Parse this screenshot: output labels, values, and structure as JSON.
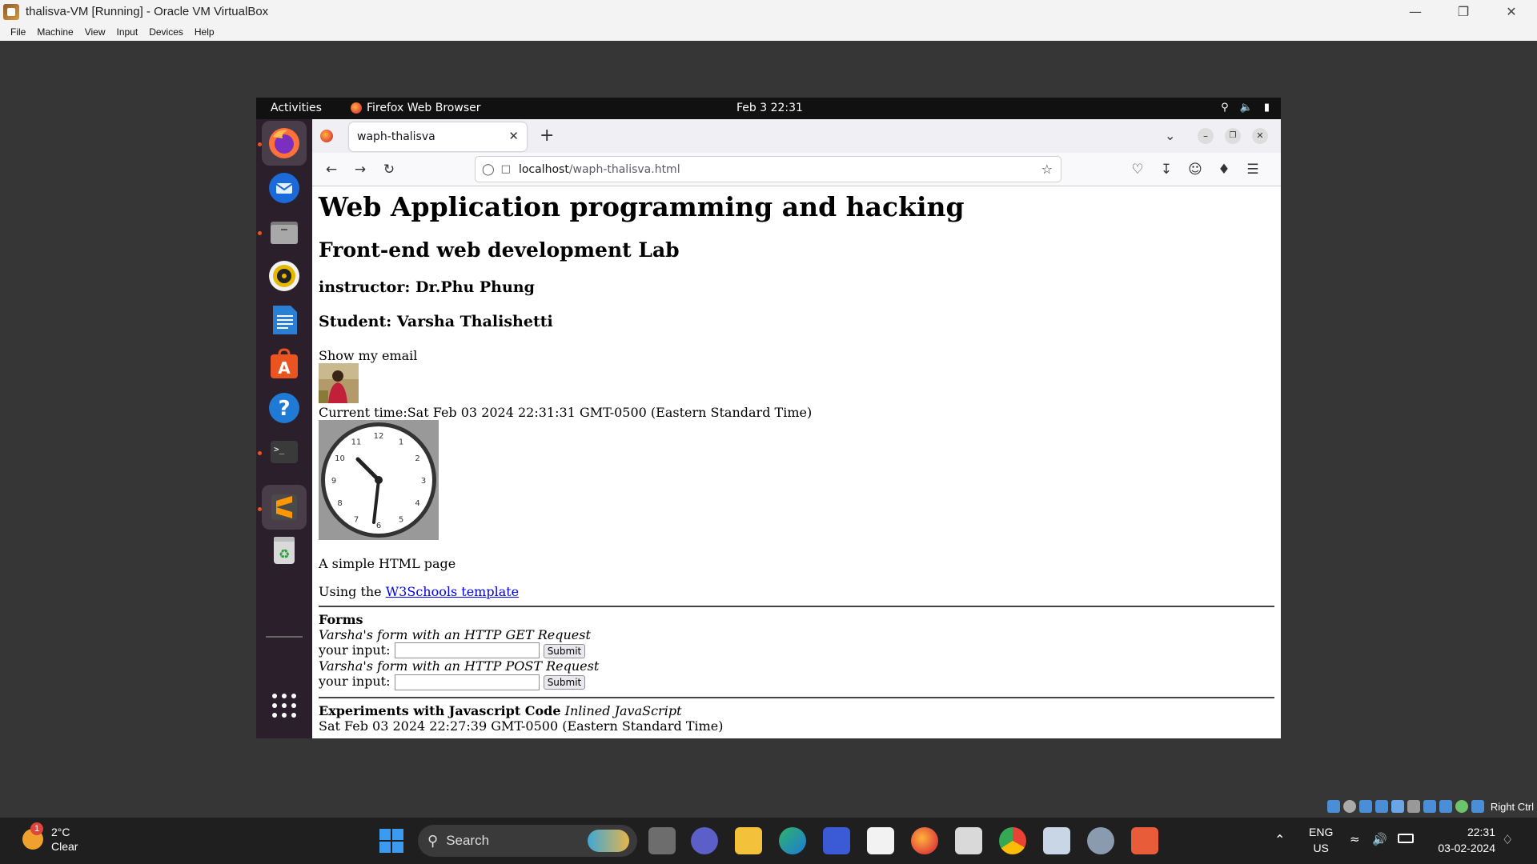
{
  "host_window": {
    "title": "thalisva-VM [Running] - Oracle VM VirtualBox",
    "menu": [
      "File",
      "Machine",
      "View",
      "Input",
      "Devices",
      "Help"
    ],
    "host_key_label": "Right Ctrl"
  },
  "gnome": {
    "activities": "Activities",
    "app_name": "Firefox Web Browser",
    "clock": "Feb 3  22:31"
  },
  "firefox": {
    "tab_title": "waph-thalisva",
    "url_host": "localhost",
    "url_path": "/waph-thalisva.html"
  },
  "page": {
    "h1": "Web Application programming and hacking",
    "h2": "Front-end web development Lab",
    "instructor": "instructor: Dr.Phu Phung",
    "student": "Student: Varsha Thalishetti",
    "show_email": "Show my email",
    "current_time": "Current time:Sat Feb 03 2024 22:31:31 GMT-0500 (Eastern Standard Time)",
    "simple_page": "A simple HTML page",
    "using_the": "Using the ",
    "w3_link": "W3Schools template",
    "forms_heading": "Forms",
    "get_caption": "Varsha's form with an HTTP GET Request",
    "post_caption": "Varsha's form with an HTTP POST Request",
    "input_label": "your input:",
    "submit": "Submit",
    "js_heading": "Experiments with Javascript Code",
    "js_inline": "Inlined JavaScript",
    "js_date": "Sat Feb 03 2024 22:27:39 GMT-0500 (Eastern Standard Time)",
    "clock_numbers": [
      "12",
      "1",
      "2",
      "3",
      "4",
      "5",
      "6",
      "7",
      "8",
      "9",
      "10",
      "11"
    ]
  },
  "taskbar": {
    "weather_temp": "2°C",
    "weather_desc": "Clear",
    "weather_badge": "1",
    "search": "Search",
    "lang_top": "ENG",
    "lang_bottom": "US",
    "time": "22:31",
    "date": "03-02-2024"
  }
}
